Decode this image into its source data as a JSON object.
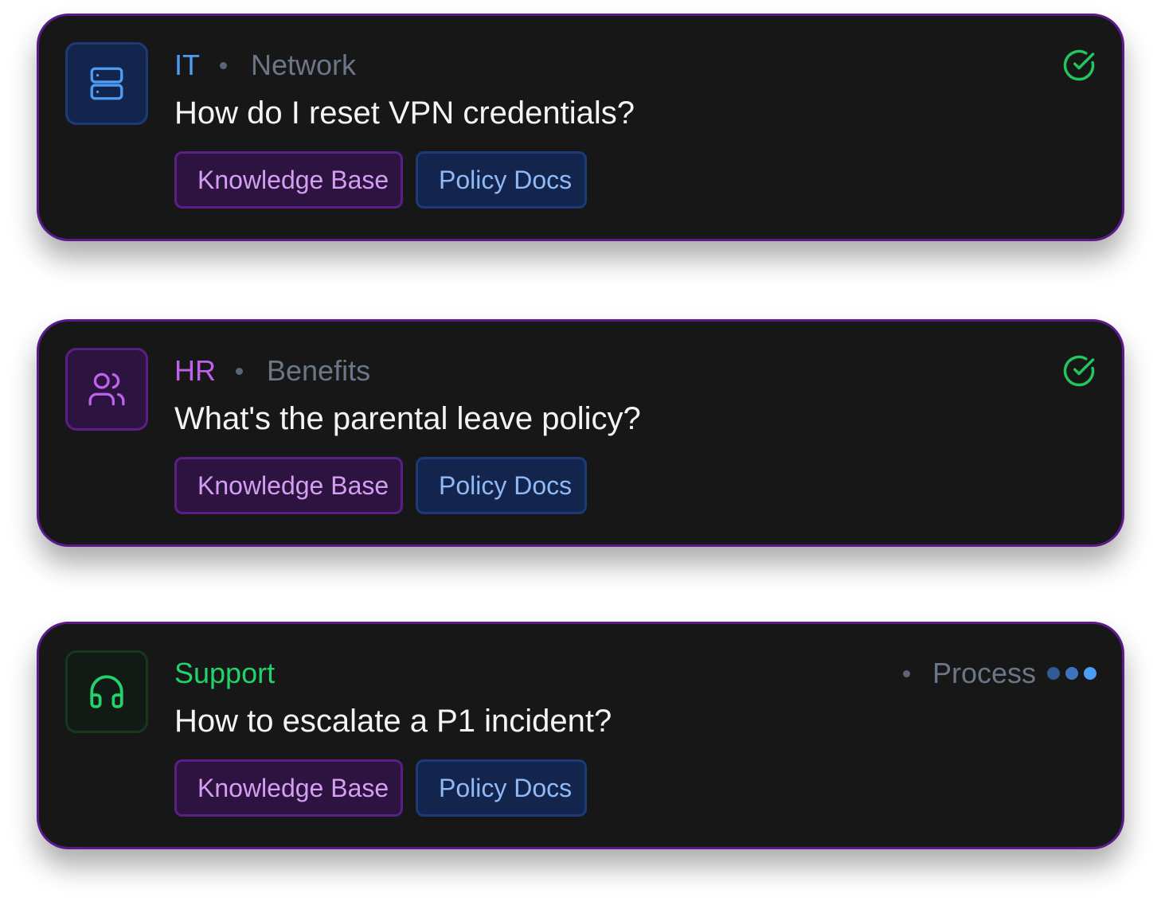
{
  "colors": {
    "card_bg": "#171717",
    "card_border": "#5b1a8c",
    "it_accent": "#4d9cf5",
    "hr_accent": "#c061ee",
    "support_accent": "#22d36c",
    "muted": "#6b7686",
    "check_green": "#22c55e"
  },
  "cards": [
    {
      "category": "IT",
      "subcategory": "Network",
      "question": "How do I reset VPN credentials?",
      "icon": "server-icon",
      "status": "complete",
      "status_icon": "check-circle-icon",
      "tags": [
        "Knowledge Base",
        "Policy Docs"
      ]
    },
    {
      "category": "HR",
      "subcategory": "Benefits",
      "question": "What's the parental leave policy?",
      "icon": "users-icon",
      "status": "complete",
      "status_icon": "check-circle-icon",
      "tags": [
        "Knowledge Base",
        "Policy Docs"
      ]
    },
    {
      "category": "Support",
      "question": "How to escalate a P1 incident?",
      "icon": "headphones-icon",
      "status": "processing",
      "status_label": "Process",
      "status_icon": "loading-dots-icon",
      "tags": [
        "Knowledge Base",
        "Policy Docs"
      ]
    }
  ]
}
